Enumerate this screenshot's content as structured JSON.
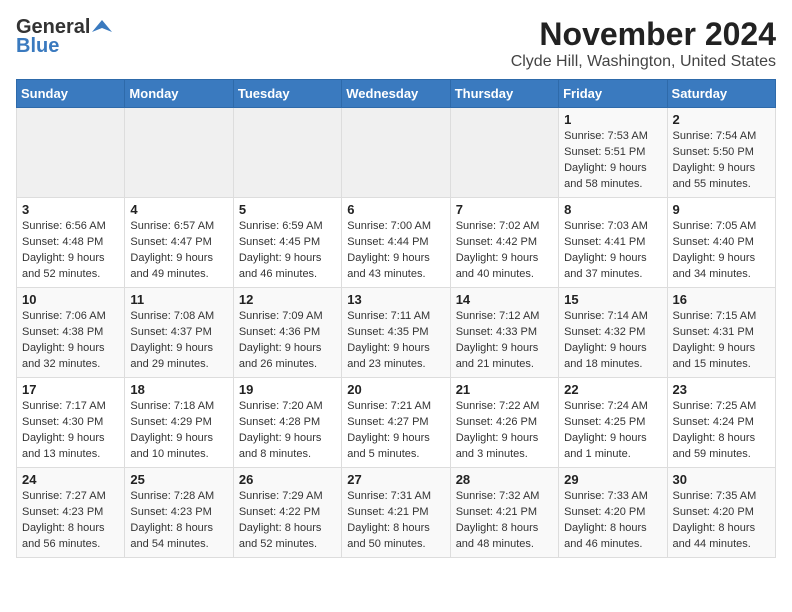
{
  "logo": {
    "general": "General",
    "blue": "Blue"
  },
  "title": {
    "month_year": "November 2024",
    "location": "Clyde Hill, Washington, United States"
  },
  "days_of_week": [
    "Sunday",
    "Monday",
    "Tuesday",
    "Wednesday",
    "Thursday",
    "Friday",
    "Saturday"
  ],
  "weeks": [
    [
      {
        "day": "",
        "sunrise": "",
        "sunset": "",
        "daylight": "",
        "empty": true
      },
      {
        "day": "",
        "sunrise": "",
        "sunset": "",
        "daylight": "",
        "empty": true
      },
      {
        "day": "",
        "sunrise": "",
        "sunset": "",
        "daylight": "",
        "empty": true
      },
      {
        "day": "",
        "sunrise": "",
        "sunset": "",
        "daylight": "",
        "empty": true
      },
      {
        "day": "",
        "sunrise": "",
        "sunset": "",
        "daylight": "",
        "empty": true
      },
      {
        "day": "1",
        "sunrise": "Sunrise: 7:53 AM",
        "sunset": "Sunset: 5:51 PM",
        "daylight": "Daylight: 9 hours and 58 minutes.",
        "empty": false
      },
      {
        "day": "2",
        "sunrise": "Sunrise: 7:54 AM",
        "sunset": "Sunset: 5:50 PM",
        "daylight": "Daylight: 9 hours and 55 minutes.",
        "empty": false
      }
    ],
    [
      {
        "day": "3",
        "sunrise": "Sunrise: 6:56 AM",
        "sunset": "Sunset: 4:48 PM",
        "daylight": "Daylight: 9 hours and 52 minutes.",
        "empty": false
      },
      {
        "day": "4",
        "sunrise": "Sunrise: 6:57 AM",
        "sunset": "Sunset: 4:47 PM",
        "daylight": "Daylight: 9 hours and 49 minutes.",
        "empty": false
      },
      {
        "day": "5",
        "sunrise": "Sunrise: 6:59 AM",
        "sunset": "Sunset: 4:45 PM",
        "daylight": "Daylight: 9 hours and 46 minutes.",
        "empty": false
      },
      {
        "day": "6",
        "sunrise": "Sunrise: 7:00 AM",
        "sunset": "Sunset: 4:44 PM",
        "daylight": "Daylight: 9 hours and 43 minutes.",
        "empty": false
      },
      {
        "day": "7",
        "sunrise": "Sunrise: 7:02 AM",
        "sunset": "Sunset: 4:42 PM",
        "daylight": "Daylight: 9 hours and 40 minutes.",
        "empty": false
      },
      {
        "day": "8",
        "sunrise": "Sunrise: 7:03 AM",
        "sunset": "Sunset: 4:41 PM",
        "daylight": "Daylight: 9 hours and 37 minutes.",
        "empty": false
      },
      {
        "day": "9",
        "sunrise": "Sunrise: 7:05 AM",
        "sunset": "Sunset: 4:40 PM",
        "daylight": "Daylight: 9 hours and 34 minutes.",
        "empty": false
      }
    ],
    [
      {
        "day": "10",
        "sunrise": "Sunrise: 7:06 AM",
        "sunset": "Sunset: 4:38 PM",
        "daylight": "Daylight: 9 hours and 32 minutes.",
        "empty": false
      },
      {
        "day": "11",
        "sunrise": "Sunrise: 7:08 AM",
        "sunset": "Sunset: 4:37 PM",
        "daylight": "Daylight: 9 hours and 29 minutes.",
        "empty": false
      },
      {
        "day": "12",
        "sunrise": "Sunrise: 7:09 AM",
        "sunset": "Sunset: 4:36 PM",
        "daylight": "Daylight: 9 hours and 26 minutes.",
        "empty": false
      },
      {
        "day": "13",
        "sunrise": "Sunrise: 7:11 AM",
        "sunset": "Sunset: 4:35 PM",
        "daylight": "Daylight: 9 hours and 23 minutes.",
        "empty": false
      },
      {
        "day": "14",
        "sunrise": "Sunrise: 7:12 AM",
        "sunset": "Sunset: 4:33 PM",
        "daylight": "Daylight: 9 hours and 21 minutes.",
        "empty": false
      },
      {
        "day": "15",
        "sunrise": "Sunrise: 7:14 AM",
        "sunset": "Sunset: 4:32 PM",
        "daylight": "Daylight: 9 hours and 18 minutes.",
        "empty": false
      },
      {
        "day": "16",
        "sunrise": "Sunrise: 7:15 AM",
        "sunset": "Sunset: 4:31 PM",
        "daylight": "Daylight: 9 hours and 15 minutes.",
        "empty": false
      }
    ],
    [
      {
        "day": "17",
        "sunrise": "Sunrise: 7:17 AM",
        "sunset": "Sunset: 4:30 PM",
        "daylight": "Daylight: 9 hours and 13 minutes.",
        "empty": false
      },
      {
        "day": "18",
        "sunrise": "Sunrise: 7:18 AM",
        "sunset": "Sunset: 4:29 PM",
        "daylight": "Daylight: 9 hours and 10 minutes.",
        "empty": false
      },
      {
        "day": "19",
        "sunrise": "Sunrise: 7:20 AM",
        "sunset": "Sunset: 4:28 PM",
        "daylight": "Daylight: 9 hours and 8 minutes.",
        "empty": false
      },
      {
        "day": "20",
        "sunrise": "Sunrise: 7:21 AM",
        "sunset": "Sunset: 4:27 PM",
        "daylight": "Daylight: 9 hours and 5 minutes.",
        "empty": false
      },
      {
        "day": "21",
        "sunrise": "Sunrise: 7:22 AM",
        "sunset": "Sunset: 4:26 PM",
        "daylight": "Daylight: 9 hours and 3 minutes.",
        "empty": false
      },
      {
        "day": "22",
        "sunrise": "Sunrise: 7:24 AM",
        "sunset": "Sunset: 4:25 PM",
        "daylight": "Daylight: 9 hours and 1 minute.",
        "empty": false
      },
      {
        "day": "23",
        "sunrise": "Sunrise: 7:25 AM",
        "sunset": "Sunset: 4:24 PM",
        "daylight": "Daylight: 8 hours and 59 minutes.",
        "empty": false
      }
    ],
    [
      {
        "day": "24",
        "sunrise": "Sunrise: 7:27 AM",
        "sunset": "Sunset: 4:23 PM",
        "daylight": "Daylight: 8 hours and 56 minutes.",
        "empty": false
      },
      {
        "day": "25",
        "sunrise": "Sunrise: 7:28 AM",
        "sunset": "Sunset: 4:23 PM",
        "daylight": "Daylight: 8 hours and 54 minutes.",
        "empty": false
      },
      {
        "day": "26",
        "sunrise": "Sunrise: 7:29 AM",
        "sunset": "Sunset: 4:22 PM",
        "daylight": "Daylight: 8 hours and 52 minutes.",
        "empty": false
      },
      {
        "day": "27",
        "sunrise": "Sunrise: 7:31 AM",
        "sunset": "Sunset: 4:21 PM",
        "daylight": "Daylight: 8 hours and 50 minutes.",
        "empty": false
      },
      {
        "day": "28",
        "sunrise": "Sunrise: 7:32 AM",
        "sunset": "Sunset: 4:21 PM",
        "daylight": "Daylight: 8 hours and 48 minutes.",
        "empty": false
      },
      {
        "day": "29",
        "sunrise": "Sunrise: 7:33 AM",
        "sunset": "Sunset: 4:20 PM",
        "daylight": "Daylight: 8 hours and 46 minutes.",
        "empty": false
      },
      {
        "day": "30",
        "sunrise": "Sunrise: 7:35 AM",
        "sunset": "Sunset: 4:20 PM",
        "daylight": "Daylight: 8 hours and 44 minutes.",
        "empty": false
      }
    ]
  ]
}
